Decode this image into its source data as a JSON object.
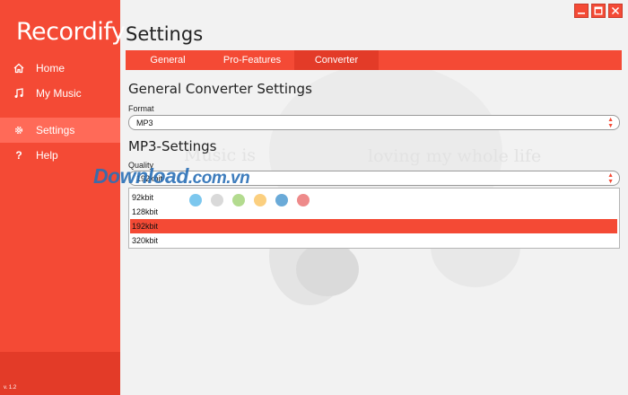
{
  "app": {
    "logo": "Recordify",
    "version": "v. 1.2"
  },
  "window": {
    "minimize_icon": "minimize-icon",
    "maximize_icon": "maximize-icon",
    "close_icon": "close-icon"
  },
  "sidebar": {
    "items": [
      {
        "label": "Home",
        "icon": "home-icon"
      },
      {
        "label": "My Music",
        "icon": "music-note-icon"
      },
      {
        "label": "Settings",
        "icon": "gear-icon",
        "active": true
      },
      {
        "label": "Help",
        "icon": "question-icon"
      }
    ]
  },
  "page": {
    "title": "Settings",
    "tabs": [
      {
        "label": "General"
      },
      {
        "label": "Pro-Features"
      },
      {
        "label": "Converter",
        "active": true
      }
    ]
  },
  "converter": {
    "section_title": "General Converter Settings",
    "format_label": "Format",
    "format_value": "MP3",
    "mp3_title": "MP3-Settings",
    "quality_label": "Quality",
    "quality_value": "192kbit",
    "quality_options": [
      "92kbit",
      "128kbit",
      "192kbit",
      "320kbit"
    ],
    "selected_index": 2
  },
  "background": {
    "text": "loving my whole life",
    "text_left": "Music is"
  },
  "watermark": {
    "main": "Download",
    "tld": ".com.vn"
  },
  "colors": {
    "accent": "#f44a35",
    "accent_dark": "#e33b28",
    "accent_light": "#ff6a58"
  },
  "decor_dots": [
    "#7cc7ee",
    "#d9d9d9",
    "#b3db8f",
    "#fbcf7f",
    "#6aaad8",
    "#ee8a8a"
  ]
}
